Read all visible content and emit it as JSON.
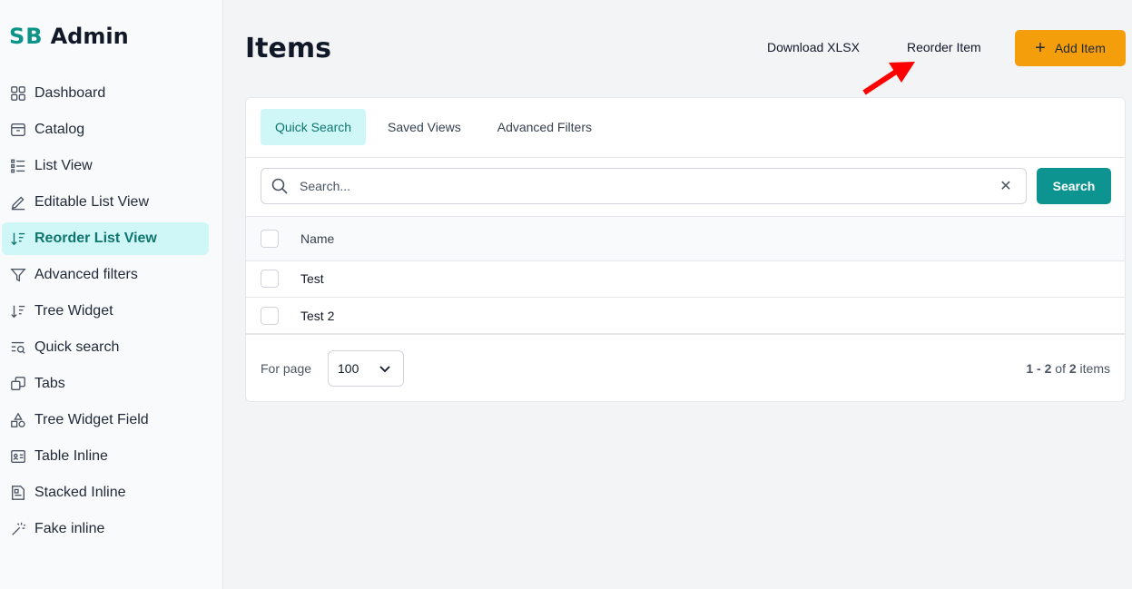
{
  "brand": {
    "mark": "SB",
    "name": "Admin"
  },
  "sidebar": {
    "items": [
      {
        "label": "Dashboard",
        "icon": "dashboard-grid-icon"
      },
      {
        "label": "Catalog",
        "icon": "archive-box-icon"
      },
      {
        "label": "List View",
        "icon": "list-icon"
      },
      {
        "label": "Editable List View",
        "icon": "pencil-icon"
      },
      {
        "label": "Reorder List View",
        "icon": "sort-icon",
        "active": true
      },
      {
        "label": "Advanced filters",
        "icon": "filter-icon"
      },
      {
        "label": "Tree Widget",
        "icon": "sort-icon"
      },
      {
        "label": "Quick search",
        "icon": "list-search-icon"
      },
      {
        "label": "Tabs",
        "icon": "squares-icon"
      },
      {
        "label": "Tree Widget Field",
        "icon": "shapes-icon"
      },
      {
        "label": "Table Inline",
        "icon": "id-card-icon"
      },
      {
        "label": "Stacked Inline",
        "icon": "document-icon"
      },
      {
        "label": "Fake inline",
        "icon": "magic-wand-icon"
      }
    ]
  },
  "header": {
    "title": "Items",
    "download_label": "Download XLSX",
    "reorder_label": "Reorder Item",
    "add_label": "Add Item"
  },
  "tabs": [
    {
      "label": "Quick Search",
      "active": true
    },
    {
      "label": "Saved Views"
    },
    {
      "label": "Advanced Filters"
    }
  ],
  "search": {
    "placeholder": "Search...",
    "button_label": "Search"
  },
  "table": {
    "columns": [
      "Name"
    ],
    "rows": [
      {
        "name": "Test"
      },
      {
        "name": "Test 2"
      }
    ]
  },
  "pagination": {
    "for_page_label": "For page",
    "page_size": "100",
    "range": "1 - 2",
    "of": "of",
    "total": "2",
    "items_label": "items"
  },
  "colors": {
    "accent": "#0e9490",
    "add_button": "#f59e0b",
    "active_bg": "#cff7f7",
    "annotation_arrow": "#ff0000"
  }
}
